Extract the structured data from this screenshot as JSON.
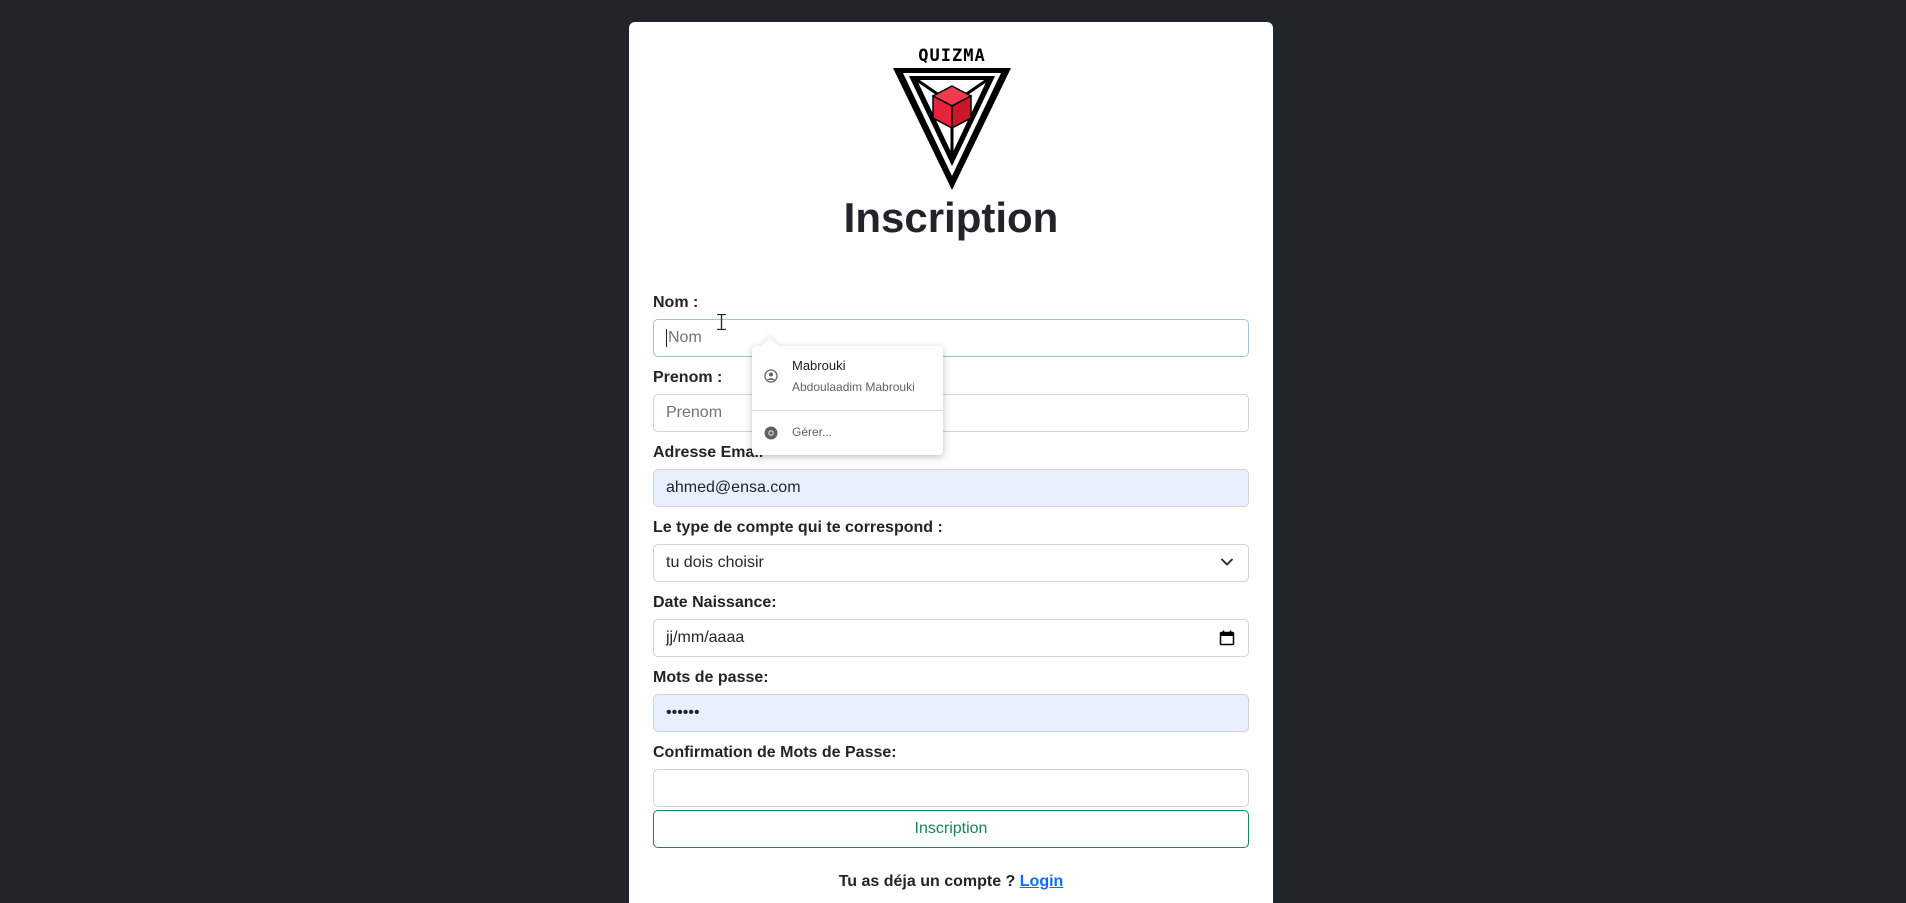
{
  "logo": {
    "text": "QUIZMA"
  },
  "page": {
    "title": "Inscription"
  },
  "form": {
    "nom": {
      "label": "Nom :",
      "placeholder": "Nom"
    },
    "prenom": {
      "label": "Prenom :",
      "placeholder": "Prenom"
    },
    "email": {
      "label": "Adresse Email",
      "value": "ahmed@ensa.com"
    },
    "account_type": {
      "label": "Le type de compte qui te correspond :",
      "selected": "tu dois choisir"
    },
    "birthdate": {
      "label": "Date Naissance:",
      "placeholder": "jj/mm/aaaa"
    },
    "password": {
      "label": "Mots de passe:",
      "value": "••••••"
    },
    "confirm_password": {
      "label": "Confirmation de Mots de Passe:",
      "value": ""
    },
    "submit_label": "Inscription"
  },
  "footer": {
    "text": "Tu as déja un compte ?",
    "link_label": "Login"
  },
  "autofill": {
    "suggestion_name": "Mabrouki",
    "suggestion_detail": "Abdoulaadim Mabrouki",
    "manage_label": "Gérer..."
  },
  "colors": {
    "background": "#212529",
    "accent_red": "#e8243c",
    "button_green": "#198754",
    "link_blue": "#0d6efd",
    "autofill_bg": "#e8f0fe"
  }
}
